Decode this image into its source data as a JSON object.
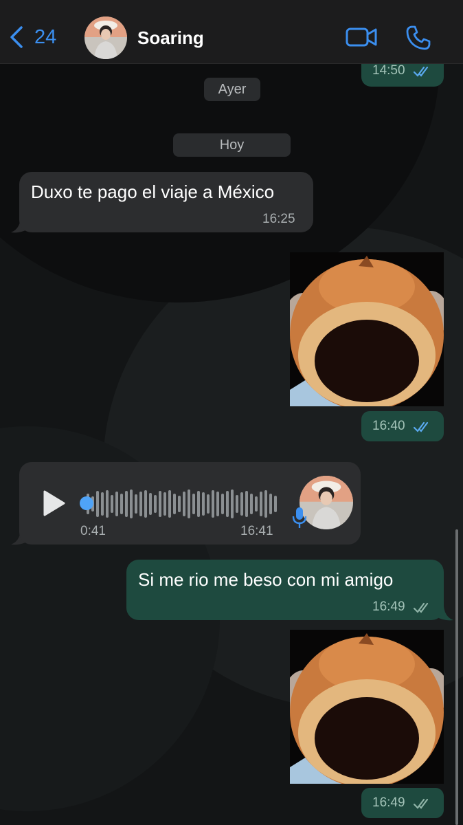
{
  "header": {
    "back_count": "24",
    "contact_name": "Soaring"
  },
  "date_separators": {
    "yesterday": "Ayer",
    "today": "Hoy"
  },
  "messages": {
    "prev_outgoing_time": "14:50",
    "incoming_text_1": {
      "text": "Duxo te pago el viaje a México",
      "time": "16:25"
    },
    "sticker_1_time": "16:40",
    "voice_note": {
      "duration": "0:41",
      "time": "16:41"
    },
    "outgoing_text_1": {
      "text": "Si me rio me beso con mi amigo",
      "time": "16:49"
    },
    "sticker_2_time": "16:49"
  },
  "colors": {
    "accent_blue": "#3b8ff0",
    "outgoing_bubble": "#1e4a3f",
    "incoming_bubble": "#2c2d2f",
    "read_tick": "#5aa9ef"
  },
  "icons": {
    "back": "chevron-left-icon",
    "video": "video-camera-icon",
    "call": "phone-icon",
    "play": "play-icon",
    "mic": "microphone-icon",
    "ticks": "double-check-icon"
  }
}
